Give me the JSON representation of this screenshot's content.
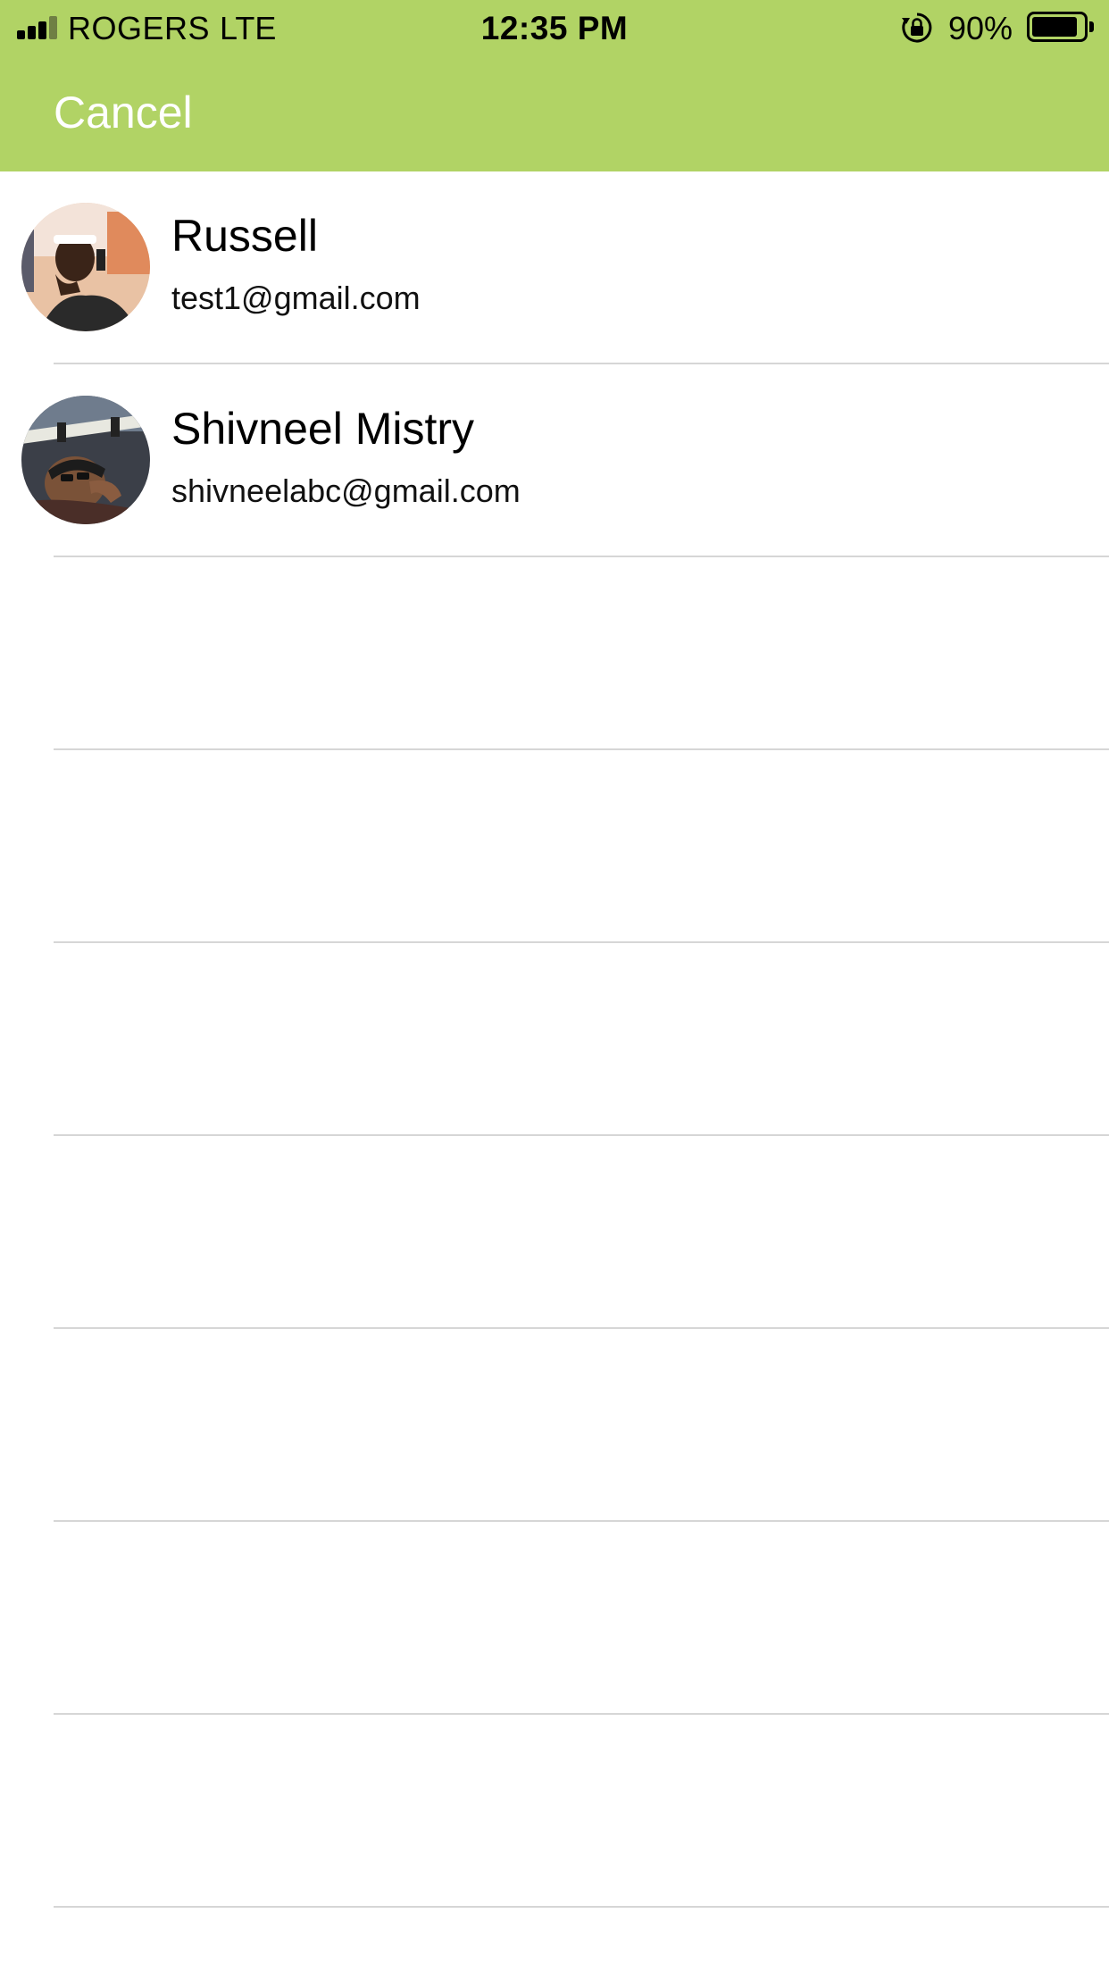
{
  "status_bar": {
    "carrier": "ROGERS",
    "network": "LTE",
    "time": "12:35 PM",
    "battery_percent": "90%",
    "icons": [
      "signal-icon",
      "rotation-lock-icon",
      "battery-icon"
    ],
    "battery_level": 0.9
  },
  "nav": {
    "cancel_label": "Cancel"
  },
  "contacts": [
    {
      "name": "Russell",
      "email": "test1@gmail.com"
    },
    {
      "name": "Shivneel Mistry",
      "email": "shivneelabc@gmail.com"
    }
  ],
  "empty_rows": 7,
  "colors": {
    "header_bg": "#b1d365",
    "divider": "#d6d6d6",
    "cancel_text": "#ffffff"
  }
}
